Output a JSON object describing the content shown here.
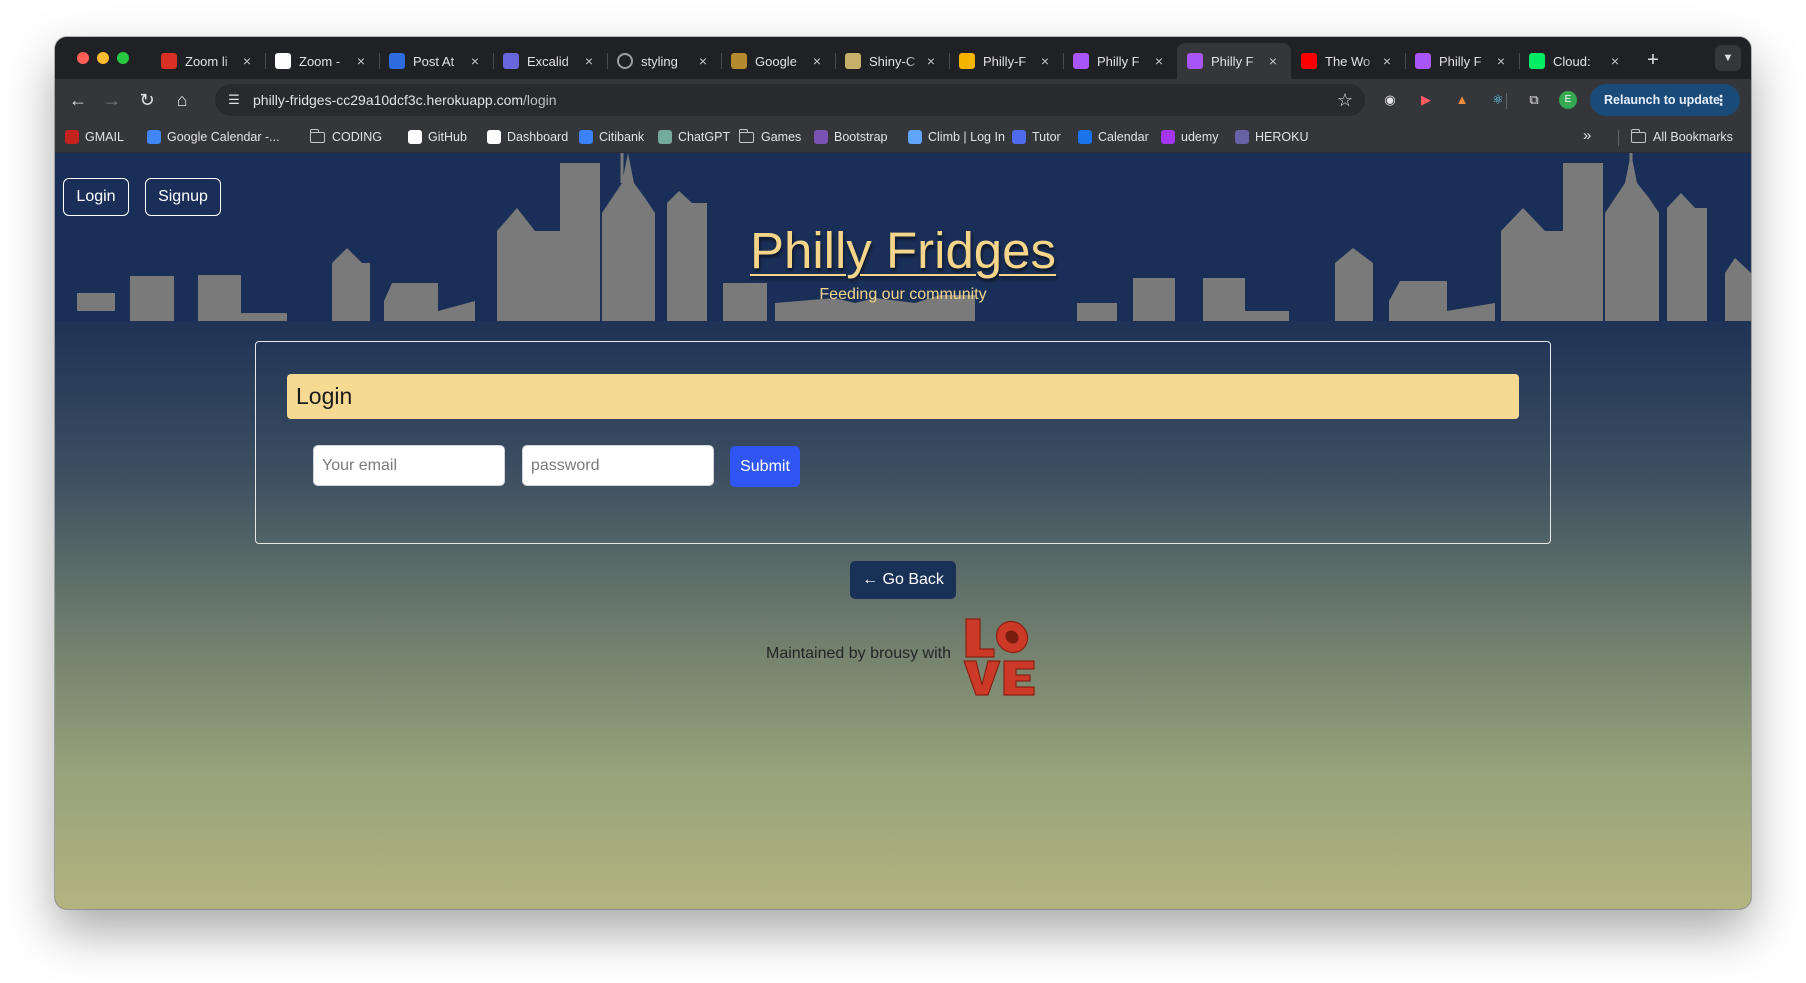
{
  "browser": {
    "tabs": [
      {
        "title": "Zoom li",
        "icon": "zoom-favicon",
        "color": "#d93025"
      },
      {
        "title": "Zoom -",
        "icon": "penn-favicon",
        "color": "#ffffff"
      },
      {
        "title": "Post At",
        "icon": "zoom-blue-favicon",
        "color": "#2d6cdf"
      },
      {
        "title": "Excalid",
        "icon": "excalidraw-favicon",
        "color": "#6965db"
      },
      {
        "title": "styling",
        "icon": "loading-spinner-icon",
        "color": "#9aa0a6"
      },
      {
        "title": "Google",
        "icon": "google-cloud-favicon",
        "color": "#b48a2f"
      },
      {
        "title": "Shiny-C",
        "icon": "shiny-favicon",
        "color": "#c9b06a"
      },
      {
        "title": "Philly-F",
        "icon": "slides-favicon",
        "color": "#f4b400"
      },
      {
        "title": "Philly F",
        "icon": "vite-favicon",
        "color": "#a855f7"
      },
      {
        "title": "Philly F",
        "icon": "vite-favicon",
        "color": "#a855f7"
      },
      {
        "title": "The Wo",
        "icon": "youtube-favicon",
        "color": "#ff0000"
      },
      {
        "title": "Philly F",
        "icon": "vite-favicon",
        "color": "#a855f7"
      },
      {
        "title": "Cloud:",
        "icon": "mongodb-favicon",
        "color": "#00ed64"
      }
    ],
    "active_tab_index": 9,
    "url_host": "philly-fridges-cc29a10dcf3c.herokuapp.com",
    "url_path": "/login",
    "profile_initial": "E",
    "relaunch_label": "Relaunch to update",
    "bookmarks": [
      {
        "label": "GMAIL",
        "icon": "gmail-icon",
        "type": "link",
        "color": "#c5221f"
      },
      {
        "label": "Google Calendar -...",
        "icon": "google-calendar-icon",
        "type": "link",
        "color": "#4285f4"
      },
      {
        "label": "CODING",
        "icon": "folder-icon",
        "type": "folder",
        "color": "#c4c7c5"
      },
      {
        "label": "GitHub",
        "icon": "github-icon",
        "type": "link",
        "color": "#ffffff"
      },
      {
        "label": "Dashboard",
        "icon": "penn-icon",
        "type": "link",
        "color": "#ffffff"
      },
      {
        "label": "Citibank",
        "icon": "citibank-icon",
        "type": "link",
        "color": "#3b82f6"
      },
      {
        "label": "ChatGPT",
        "icon": "chatgpt-icon",
        "type": "link",
        "color": "#74aa9c"
      },
      {
        "label": "Games",
        "icon": "folder-icon",
        "type": "folder",
        "color": "#c4c7c5"
      },
      {
        "label": "Bootstrap",
        "icon": "bootstrap-icon",
        "type": "link",
        "color": "#7952b3"
      },
      {
        "label": "Climb | Log In",
        "icon": "climb-icon",
        "type": "link",
        "color": "#60a5fa"
      },
      {
        "label": "Tutor",
        "icon": "tutor-icon",
        "type": "link",
        "color": "#4f6bed"
      },
      {
        "label": "Calendar",
        "icon": "calendar-icon",
        "type": "link",
        "color": "#1a73e8"
      },
      {
        "label": "udemy",
        "icon": "udemy-icon",
        "type": "link",
        "color": "#a435f0"
      },
      {
        "label": "HEROKU",
        "icon": "heroku-icon",
        "type": "link",
        "color": "#6762a6"
      }
    ],
    "all_bookmarks_label": "All Bookmarks"
  },
  "page": {
    "nav": {
      "login_label": "Login",
      "signup_label": "Signup"
    },
    "title": "Philly Fridges",
    "tagline": "Feeding our community",
    "login_form": {
      "heading": "Login",
      "email_placeholder": "Your email",
      "password_placeholder": "password",
      "submit_label": "Submit"
    },
    "go_back_label": "← Go Back",
    "footer_text": "Maintained by brousy with",
    "colors": {
      "accent_gold": "#f6d993",
      "navy": "#1a3157",
      "submit_blue": "#2f55f4",
      "love_red": "#cc3a27"
    }
  }
}
